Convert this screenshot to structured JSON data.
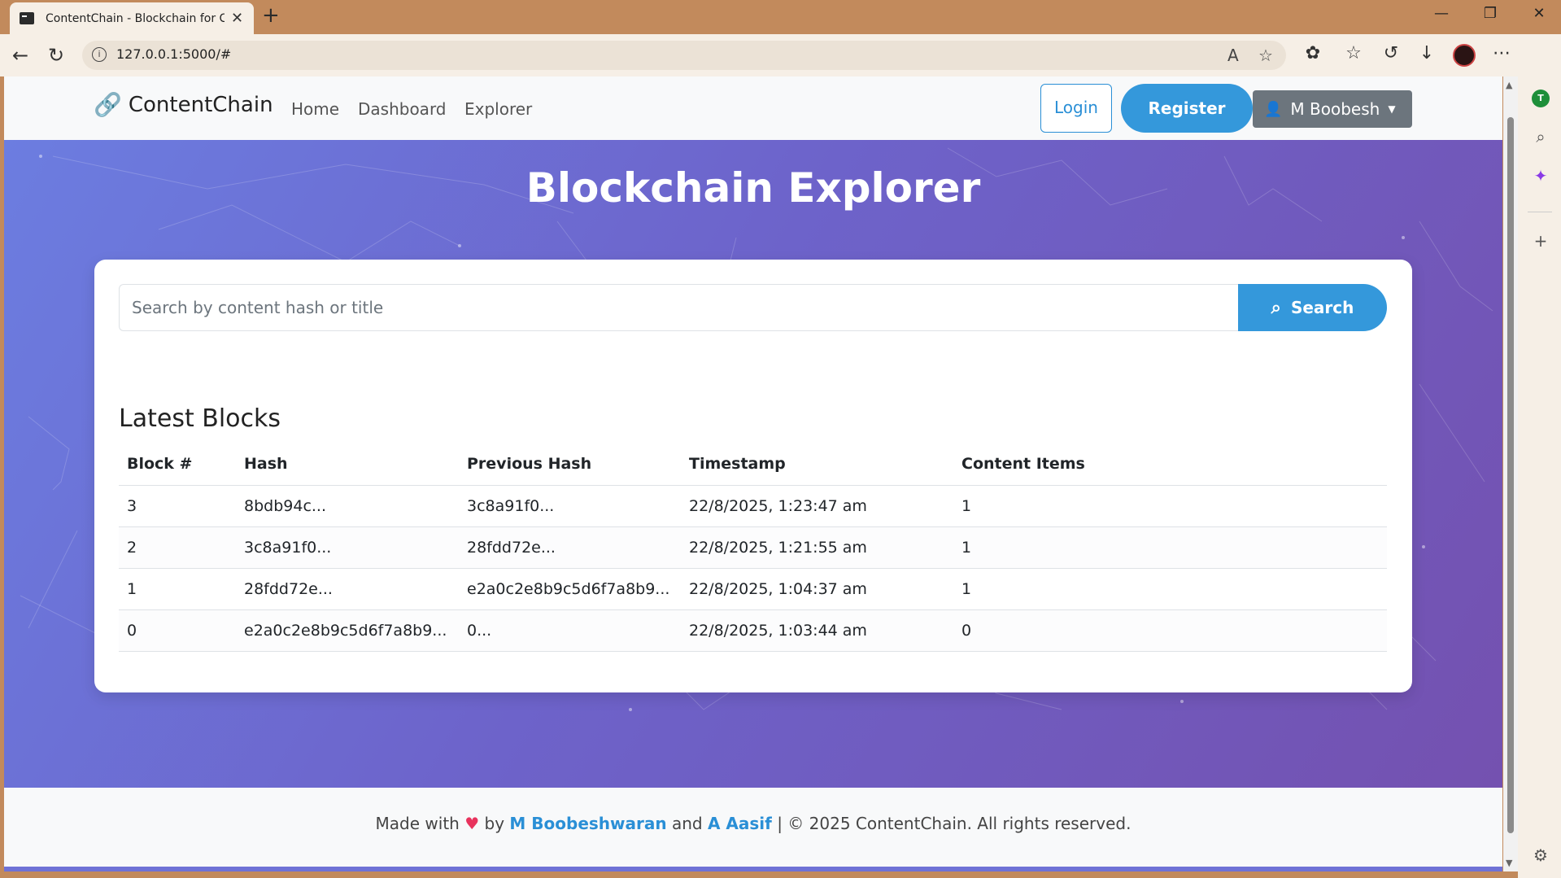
{
  "browser": {
    "tab_title": "ContentChain - Blockchain for Co",
    "url": "127.0.0.1:5000/#",
    "sidebar_avatar": "T"
  },
  "nav": {
    "brand": "ContentChain",
    "links": [
      "Home",
      "Dashboard",
      "Explorer"
    ],
    "login": "Login",
    "register": "Register",
    "user": "M Boobesh"
  },
  "hero": {
    "title": "Blockchain Explorer"
  },
  "search": {
    "placeholder": "Search by content hash or title",
    "button": "Search"
  },
  "blocks": {
    "title": "Latest Blocks",
    "columns": [
      "Block #",
      "Hash",
      "Previous Hash",
      "Timestamp",
      "Content Items"
    ],
    "rows": [
      [
        "3",
        "8bdb94c...",
        "3c8a91f0...",
        "22/8/2025, 1:23:47 am",
        "1"
      ],
      [
        "2",
        "3c8a91f0...",
        "28fdd72e...",
        "22/8/2025, 1:21:55 am",
        "1"
      ],
      [
        "1",
        "28fdd72e...",
        "e2a0c2e8b9c5d6f7a8b9...",
        "22/8/2025, 1:04:37 am",
        "1"
      ],
      [
        "0",
        "e2a0c2e8b9c5d6f7a8b9...",
        "0...",
        "22/8/2025, 1:03:44 am",
        "0"
      ]
    ]
  },
  "footer": {
    "made_with": "Made with",
    "by": "by",
    "author1": "M Boobeshwaran",
    "and": "and",
    "author2": "A Aasif",
    "rest": "| © 2025 ContentChain. All rights reserved."
  },
  "colors": {
    "accent": "#3498db",
    "hero_start": "#6c7de0",
    "hero_end": "#7451b0",
    "heart": "#e8335d"
  }
}
